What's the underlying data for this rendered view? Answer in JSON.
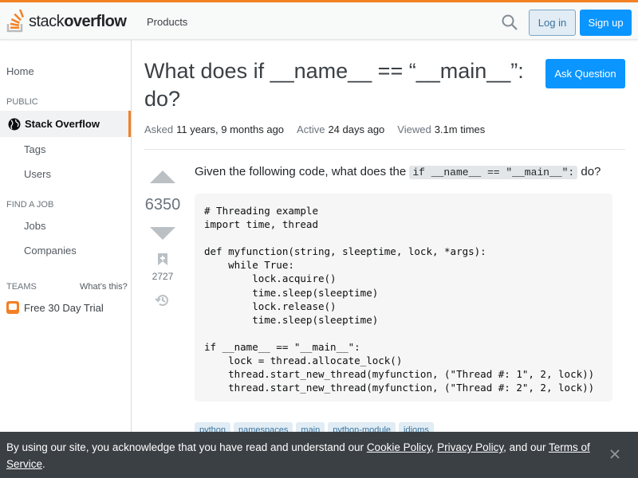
{
  "header": {
    "logo_text_light": "stack",
    "logo_text_bold": "overflow",
    "products_label": "Products",
    "login_label": "Log in",
    "signup_label": "Sign up",
    "icons": {
      "search": "search-icon",
      "logo": "stackoverflow-logo-icon"
    },
    "colors": {
      "accent": "#f48024",
      "primary": "#0a95ff"
    }
  },
  "sidebar": {
    "home": "Home",
    "public_heading": "PUBLIC",
    "stack_overflow": "Stack Overflow",
    "tags": "Tags",
    "users": "Users",
    "find_job_heading": "FIND A JOB",
    "jobs": "Jobs",
    "companies": "Companies",
    "teams_heading": "TEAMS",
    "whats_this": "What’s this?",
    "free_trial": "Free 30 Day Trial"
  },
  "question": {
    "title": "What does if __name__ == “__main__”: do?",
    "ask_button": "Ask Question",
    "asked_label": "Asked",
    "asked_value": "11 years, 9 months ago",
    "active_label": "Active",
    "active_value": "24 days ago",
    "viewed_label": "Viewed",
    "viewed_value": "3.1m times",
    "votes": "6350",
    "bookmarks": "2727",
    "body_prefix": "Given the following code, what does the",
    "body_code": "if __name__ == \"__main__\":",
    "body_suffix": "do?",
    "code": "# Threading example\nimport time, thread\n\ndef myfunction(string, sleeptime, lock, *args):\n    while True:\n        lock.acquire()\n        time.sleep(sleeptime)\n        lock.release()\n        time.sleep(sleeptime)\n\nif __name__ == \"__main__\":\n    lock = thread.allocate_lock()\n    thread.start_new_thread(myfunction, (\"Thread #: 1\", 2, lock))\n    thread.start_new_thread(myfunction, (\"Thread #: 2\", 2, lock))",
    "tags": [
      "python",
      "namespaces",
      "main",
      "python-module",
      "idioms"
    ]
  },
  "cookie_banner": {
    "text_1": "By using our site, you acknowledge that you have read and understand our",
    "cookie_policy": "Cookie Policy",
    "comma": ",",
    "privacy_policy": "Privacy Policy",
    "text_2": ", and our",
    "terms_of_service": "Terms of Service",
    "period": "."
  }
}
